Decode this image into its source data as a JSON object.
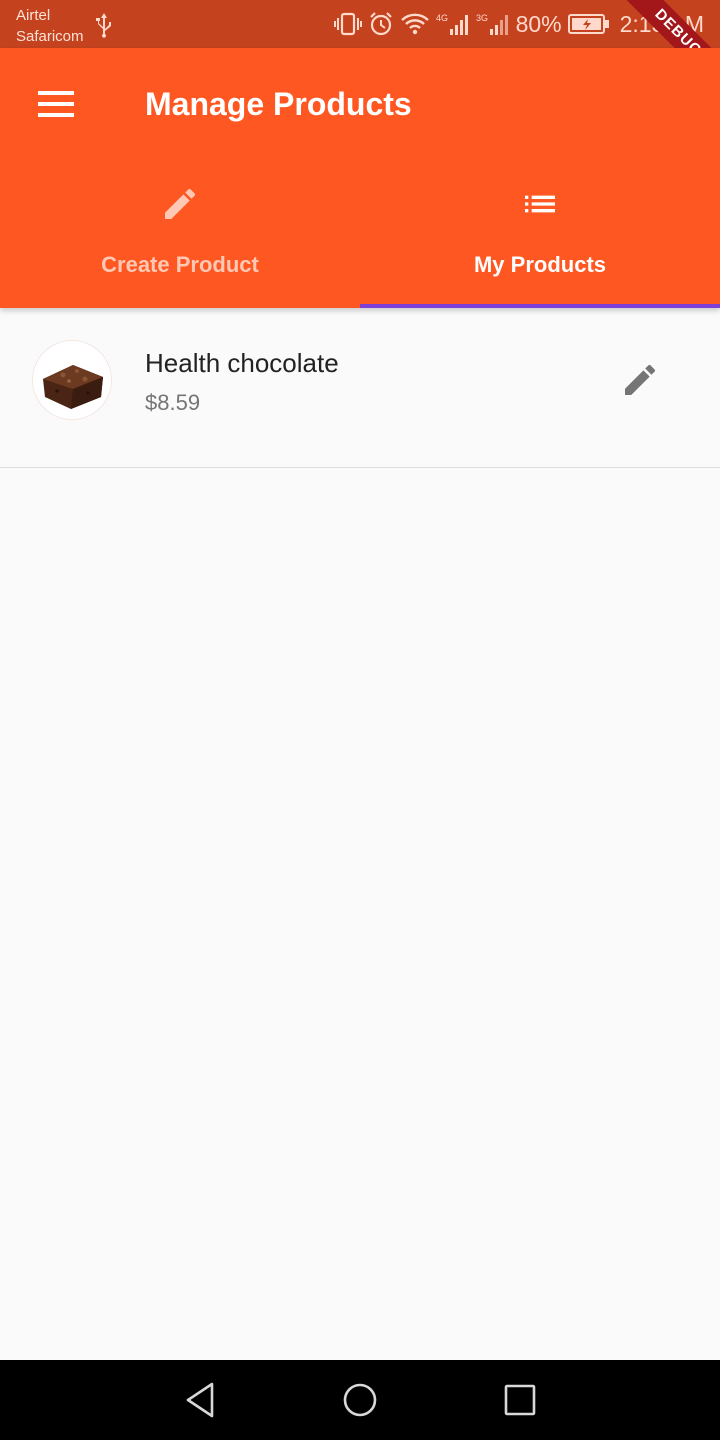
{
  "status_bar": {
    "carrier_1": "Airtel",
    "carrier_2": "Safaricom",
    "network_1": "4G",
    "network_2": "3G",
    "battery": "80%",
    "time": "2:13 AM",
    "background_color": "#c4421e"
  },
  "debug_banner": "DEBUG",
  "app_bar": {
    "title": "Manage Products",
    "menu_icon": "menu-icon",
    "background_color": "#ff5722"
  },
  "tabs": [
    {
      "label": "Create Product",
      "icon": "pencil-icon",
      "selected": false
    },
    {
      "label": "My Products",
      "icon": "list-icon",
      "selected": true
    }
  ],
  "tab_indicator_color": "#7e3fd8",
  "products": [
    {
      "name": "Health chocolate",
      "price": "$8.59",
      "image": "brownie-image",
      "action_icon": "edit-icon"
    }
  ],
  "nav_bar": {
    "buttons": [
      "back-icon",
      "home-icon",
      "recent-apps-icon"
    ]
  }
}
